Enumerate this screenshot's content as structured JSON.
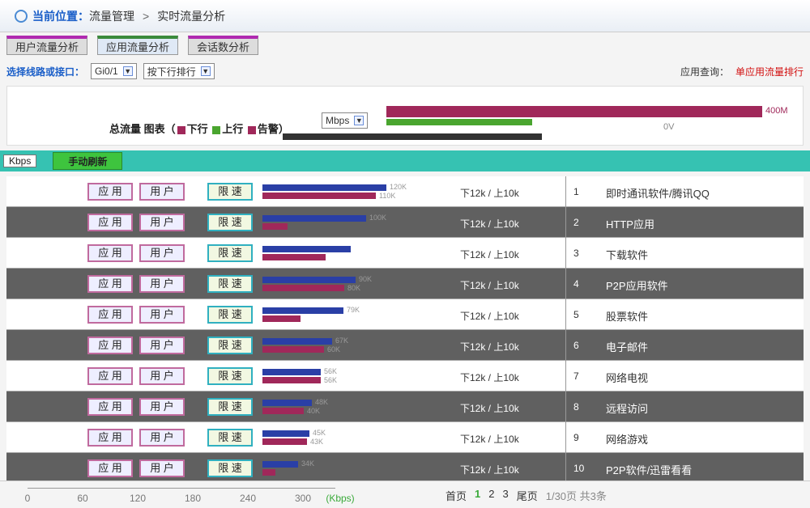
{
  "breadcrumb": {
    "label": "当前位置：",
    "path1": "流量管理",
    "sep": ">",
    "path2": "实时流量分析"
  },
  "tabs": [
    "用户流量分析",
    "应用流量分析",
    "会话数分析"
  ],
  "controls": {
    "select_label": "选择线路或接口：",
    "interface": "Gi0/1",
    "sort": "按下行排行",
    "hint_prefix": "应用查询：",
    "hint": "单应用流量排行"
  },
  "total": {
    "title_prefix": "总流量 图表（",
    "legend_down": "下行",
    "legend_up": "上行",
    "legend_alarm": "告警）",
    "unit": "Mbps",
    "down_label": "400M",
    "up_label": "0V",
    "colors": {
      "down": "#a0285a",
      "up": "#4aa52f",
      "alarm": "#a0285a"
    }
  },
  "header": {
    "unit": "Kbps",
    "refresh": "手动刷新"
  },
  "buttons": {
    "app": "应 用",
    "user": "用 户",
    "speed": "限 速"
  },
  "rows": [
    {
      "rank": "1",
      "name": "即时通讯软件/腾讯QQ",
      "rate": "下12k / 上10k",
      "down": "120K",
      "up": "110K",
      "down_frac": 0.98,
      "up_frac": 0.9
    },
    {
      "rank": "2",
      "name": "HTTP应用",
      "rate": "下12k / 上10k",
      "down": "100K",
      "up": "",
      "down_frac": 0.82,
      "up_frac": 0.2
    },
    {
      "rank": "3",
      "name": "下载软件",
      "rate": "下12k / 上10k",
      "down": "",
      "up": "",
      "down_frac": 0.7,
      "up_frac": 0.5
    },
    {
      "rank": "4",
      "name": "P2P应用软件",
      "rate": "下12k / 上10k",
      "down": "90K",
      "up": "80K",
      "down_frac": 0.74,
      "up_frac": 0.65
    },
    {
      "rank": "5",
      "name": "股票软件",
      "rate": "下12k / 上10k",
      "down": "79K",
      "up": "",
      "down_frac": 0.64,
      "up_frac": 0.3
    },
    {
      "rank": "6",
      "name": "电子邮件",
      "rate": "下12k / 上10k",
      "down": "67K",
      "up": "60K",
      "down_frac": 0.55,
      "up_frac": 0.49
    },
    {
      "rank": "7",
      "name": "网络电视",
      "rate": "下12k / 上10k",
      "down": "56K",
      "up": "56K",
      "down_frac": 0.46,
      "up_frac": 0.46
    },
    {
      "rank": "8",
      "name": "远程访问",
      "rate": "下12k / 上10k",
      "down": "48K",
      "up": "40K",
      "down_frac": 0.39,
      "up_frac": 0.33
    },
    {
      "rank": "9",
      "name": "网络游戏",
      "rate": "下12k / 上10k",
      "down": "45K",
      "up": "43K",
      "down_frac": 0.37,
      "up_frac": 0.35
    },
    {
      "rank": "10",
      "name": "P2P软件/迅雷看看",
      "rate": "下12k / 上10k",
      "down": "34K",
      "up": "",
      "down_frac": 0.28,
      "up_frac": 0.1
    }
  ],
  "axis": {
    "ticks": [
      "0",
      "60",
      "120",
      "180",
      "240",
      "300"
    ],
    "unit": "(Kbps)"
  },
  "pager": {
    "first": "首页",
    "pages": [
      "1",
      "2",
      "3"
    ],
    "last": "尾页",
    "info": "1/30页 共3条"
  }
}
